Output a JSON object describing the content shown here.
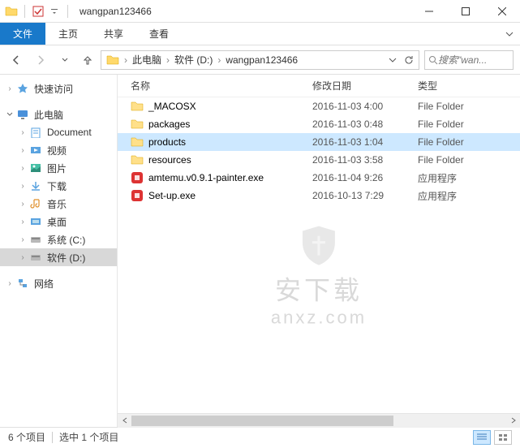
{
  "title": "wangpan123466",
  "ribbon": {
    "file": "文件",
    "home": "主页",
    "share": "共享",
    "view": "查看"
  },
  "breadcrumb": [
    "此电脑",
    "软件 (D:)",
    "wangpan123466"
  ],
  "search_placeholder": "搜索\"wan...",
  "sidebar": {
    "quick": "快速访问",
    "pc": "此电脑",
    "items": [
      "Document",
      "视频",
      "图片",
      "下载",
      "音乐",
      "桌面",
      "系统 (C:)",
      "软件 (D:)"
    ],
    "network": "网络"
  },
  "columns": {
    "name": "名称",
    "date": "修改日期",
    "type": "类型"
  },
  "type_labels": {
    "folder": "File Folder",
    "app": "应用程序"
  },
  "files": [
    {
      "name": "_MACOSX",
      "date": "2016-11-03 4:00",
      "type": "folder"
    },
    {
      "name": "packages",
      "date": "2016-11-03 0:48",
      "type": "folder"
    },
    {
      "name": "products",
      "date": "2016-11-03 1:04",
      "type": "folder",
      "selected": true
    },
    {
      "name": "resources",
      "date": "2016-11-03 3:58",
      "type": "folder"
    },
    {
      "name": "amtemu.v0.9.1-painter.exe",
      "date": "2016-11-04 9:26",
      "type": "app"
    },
    {
      "name": "Set-up.exe",
      "date": "2016-10-13 7:29",
      "type": "app"
    }
  ],
  "status": {
    "count": "6 个项目",
    "selected": "选中 1 个项目"
  },
  "watermark": {
    "line1": "安下载",
    "line2": "anxz.com"
  }
}
